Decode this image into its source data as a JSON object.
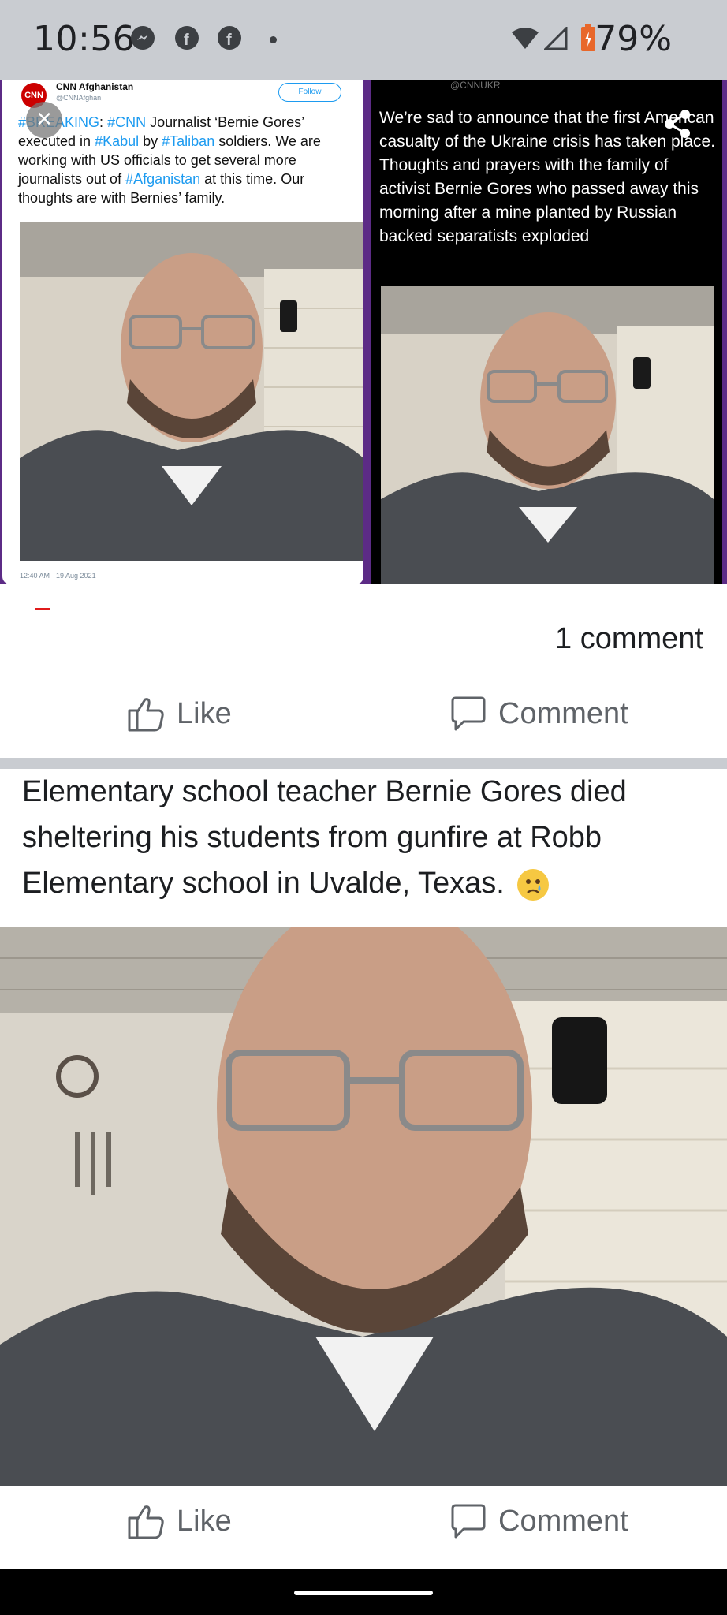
{
  "status_bar": {
    "time": "10:56",
    "icons": [
      "messenger-icon",
      "facebook-icon",
      "facebook-icon",
      "dot-icon"
    ],
    "battery": "79%"
  },
  "post1": {
    "left_tweet": {
      "logo_text": "CNN",
      "account_name": "CNN Afghanistan",
      "account_handle": "@CNNAfghan",
      "follow_label": "Follow",
      "text_parts": [
        {
          "t": "#BREAKING",
          "tag": true
        },
        {
          "t": ": ",
          "tag": false
        },
        {
          "t": "#CNN",
          "tag": true
        },
        {
          "t": " Journalist ‘Bernie Gores’ executed in ",
          "tag": false
        },
        {
          "t": "#Kabul",
          "tag": true
        },
        {
          "t": " by ",
          "tag": false
        },
        {
          "t": "#Taliban",
          "tag": true
        },
        {
          "t": " soldiers. We are working with US officials to get several more journalists out of ",
          "tag": false
        },
        {
          "t": "#Afganistan",
          "tag": true
        },
        {
          "t": " at this time. Our thoughts are with Bernies’ family.",
          "tag": false
        }
      ],
      "timestamp": "12:40 AM · 19 Aug 2021"
    },
    "right_tweet": {
      "handle": "@CNNUKR",
      "text": "We’re sad to announce that the first American casualty of the Ukraine crisis has taken place. Thoughts and prayers with the family of activist Bernie Gores who passed away this morning after a mine planted by Russian backed separatists exploded"
    },
    "comment_count": "1 comment",
    "like_label": "Like",
    "comment_label": "Comment"
  },
  "post2": {
    "text": "Elementary school teacher Bernie Gores died sheltering his students from gunfire at Robb Elementary school in Uvalde, Texas.",
    "like_label": "Like",
    "comment_label": "Comment"
  },
  "colors": {
    "accent_purple": "#5c2b86",
    "link_blue": "#1d9bf0",
    "cnn_red": "#cc0000",
    "action_gray": "#5f6368"
  }
}
